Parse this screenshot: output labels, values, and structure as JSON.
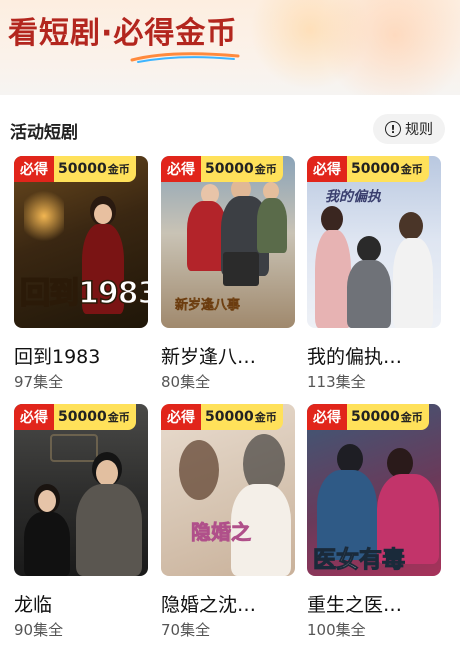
{
  "banner": {
    "title": "看短剧·必得金币"
  },
  "section": {
    "title": "活动短剧",
    "rules_label": "规则"
  },
  "badge": {
    "must": "必得",
    "amount": "50000",
    "unit": "金币"
  },
  "dramas": [
    {
      "title": "回到1983",
      "count": "97集全",
      "poster_text": "回到1983"
    },
    {
      "title": "新岁逢八…",
      "count": "80集全",
      "poster_text": "新岁逢八事"
    },
    {
      "title": "我的偏执…",
      "count": "113集全",
      "poster_text": "我的偏执"
    },
    {
      "title": "龙临",
      "count": "90集全",
      "poster_text": ""
    },
    {
      "title": "隐婚之沈…",
      "count": "70集全",
      "poster_text": "隐婚之"
    },
    {
      "title": "重生之医…",
      "count": "100集全",
      "poster_text": "医女有毒"
    }
  ],
  "colors": {
    "accent": "#e1251b",
    "coin_badge": "#ffe15a",
    "banner_title": "#b3261e"
  }
}
